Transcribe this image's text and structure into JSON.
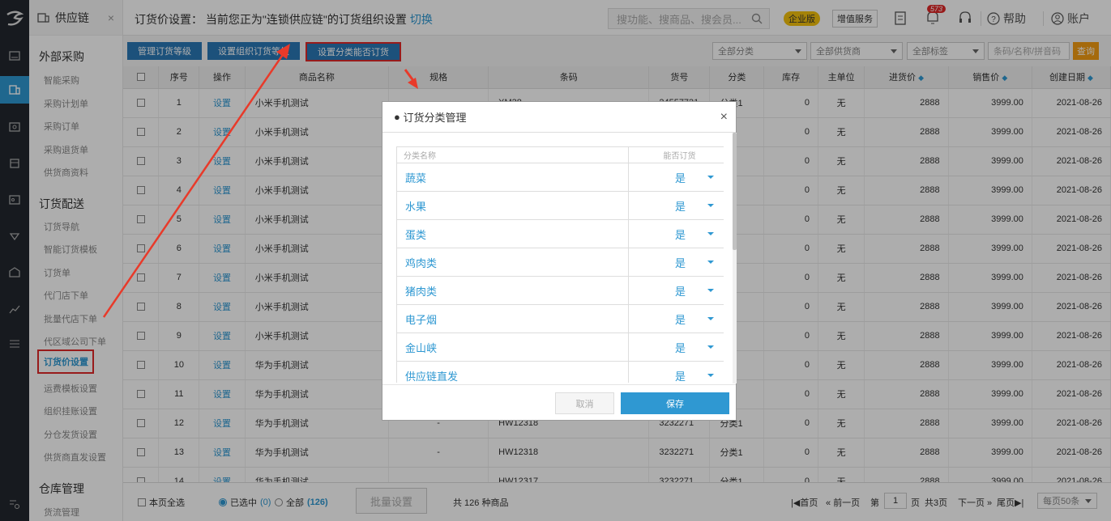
{
  "module": {
    "title": "供应链",
    "close": "×"
  },
  "sidebar": {
    "groups": [
      {
        "label": "外部采购",
        "items": [
          "智能采购",
          "采购计划单",
          "采购订单",
          "采购退货单",
          "供货商资料"
        ]
      },
      {
        "label": "订货配送",
        "items": [
          "订货导航",
          "智能订货模板",
          "订货单",
          "代门店下单",
          "批量代店下单",
          "代区域公司下单",
          "订货价设置",
          "运费模板设置",
          "组织挂账设置",
          "分仓发货设置",
          "供货商直发设置"
        ]
      },
      {
        "label": "仓库管理",
        "items": [
          "货流管理"
        ]
      }
    ],
    "selected": "订货价设置"
  },
  "header": {
    "title": "订货价设置：   当前您正为\"连锁供应链\"的订货组织设置",
    "switch": "切换",
    "search_placeholder": "搜功能、搜商品、搜会员...",
    "enterprise": "企业版",
    "value_added": "增值服务",
    "badge": "573",
    "help": "帮助",
    "account": "账户"
  },
  "toolbar": {
    "btn1": "管理订货等级",
    "btn2": "设置组织订货等级",
    "btn3": "设置分类能否订货",
    "cat": "全部分类",
    "supplier": "全部供货商",
    "tag": "全部标签",
    "search_placeholder": "条码/名称/拼音码",
    "query": "查询"
  },
  "table": {
    "headers": [
      "序号",
      "操作",
      "商品名称",
      "规格",
      "条码",
      "货号",
      "分类",
      "库存",
      "主单位",
      "进货价",
      "销售价",
      "创建日期"
    ],
    "rows": [
      {
        "no": "1",
        "op": "设置",
        "name": "小米手机测试",
        "spec": "",
        "code": "XM38",
        "sku": "24557731",
        "cat": "分类1",
        "stock": "0",
        "unit": "无",
        "buy": "2888",
        "sell": "3999.00",
        "date": "2021-08-26"
      },
      {
        "no": "2",
        "op": "设置",
        "name": "小米手机测试",
        "spec": "",
        "code": "",
        "sku": "",
        "cat": "",
        "stock": "0",
        "unit": "无",
        "buy": "2888",
        "sell": "3999.00",
        "date": "2021-08-26"
      },
      {
        "no": "3",
        "op": "设置",
        "name": "小米手机测试",
        "spec": "",
        "code": "",
        "sku": "",
        "cat": "",
        "stock": "0",
        "unit": "无",
        "buy": "2888",
        "sell": "3999.00",
        "date": "2021-08-26"
      },
      {
        "no": "4",
        "op": "设置",
        "name": "小米手机测试",
        "spec": "",
        "code": "",
        "sku": "",
        "cat": "",
        "stock": "0",
        "unit": "无",
        "buy": "2888",
        "sell": "3999.00",
        "date": "2021-08-26"
      },
      {
        "no": "5",
        "op": "设置",
        "name": "小米手机测试",
        "spec": "",
        "code": "",
        "sku": "",
        "cat": "",
        "stock": "0",
        "unit": "无",
        "buy": "2888",
        "sell": "3999.00",
        "date": "2021-08-26"
      },
      {
        "no": "6",
        "op": "设置",
        "name": "小米手机测试",
        "spec": "",
        "code": "",
        "sku": "",
        "cat": "",
        "stock": "0",
        "unit": "无",
        "buy": "2888",
        "sell": "3999.00",
        "date": "2021-08-26"
      },
      {
        "no": "7",
        "op": "设置",
        "name": "小米手机测试",
        "spec": "",
        "code": "",
        "sku": "",
        "cat": "",
        "stock": "0",
        "unit": "无",
        "buy": "2888",
        "sell": "3999.00",
        "date": "2021-08-26"
      },
      {
        "no": "8",
        "op": "设置",
        "name": "小米手机测试",
        "spec": "",
        "code": "",
        "sku": "",
        "cat": "",
        "stock": "0",
        "unit": "无",
        "buy": "2888",
        "sell": "3999.00",
        "date": "2021-08-26"
      },
      {
        "no": "9",
        "op": "设置",
        "name": "小米手机测试",
        "spec": "",
        "code": "",
        "sku": "",
        "cat": "",
        "stock": "0",
        "unit": "无",
        "buy": "2888",
        "sell": "3999.00",
        "date": "2021-08-26"
      },
      {
        "no": "10",
        "op": "设置",
        "name": "华为手机测试",
        "spec": "",
        "code": "",
        "sku": "",
        "cat": "",
        "stock": "0",
        "unit": "无",
        "buy": "2888",
        "sell": "3999.00",
        "date": "2021-08-26"
      },
      {
        "no": "11",
        "op": "设置",
        "name": "华为手机测试",
        "spec": "",
        "code": "",
        "sku": "",
        "cat": "",
        "stock": "0",
        "unit": "无",
        "buy": "2888",
        "sell": "3999.00",
        "date": "2021-08-26"
      },
      {
        "no": "12",
        "op": "设置",
        "name": "华为手机测试",
        "spec": "-",
        "code": "HW12318",
        "sku": "3232271",
        "cat": "分类1",
        "stock": "0",
        "unit": "无",
        "buy": "2888",
        "sell": "3999.00",
        "date": "2021-08-26"
      },
      {
        "no": "13",
        "op": "设置",
        "name": "华为手机测试",
        "spec": "-",
        "code": "HW12318",
        "sku": "3232271",
        "cat": "分类1",
        "stock": "0",
        "unit": "无",
        "buy": "2888",
        "sell": "3999.00",
        "date": "2021-08-26"
      },
      {
        "no": "14",
        "op": "设置",
        "name": "华为手机测试",
        "spec": "",
        "code": "HW12317",
        "sku": "3232271",
        "cat": "分类1",
        "stock": "0",
        "unit": "无",
        "buy": "2888",
        "sell": "3999.00",
        "date": "2021-08-26"
      }
    ]
  },
  "footer": {
    "page_all": "本页全选",
    "selected": "已选中",
    "selected_count": "(0)",
    "all": "全部",
    "all_count": "(126)",
    "bulk": "批量设置",
    "total": "共 126 种商品",
    "first": "首页",
    "prev": "前一页",
    "page_prefix": "第",
    "page": "1",
    "page_suffix": "页",
    "total_pages": "共3页",
    "next": "下一页",
    "last": "尾页",
    "per_page": "每页50条"
  },
  "dialog": {
    "title": "订货分类管理",
    "col_name": "分类名称",
    "col_can": "能否订货",
    "rows": [
      {
        "name": "蔬菜",
        "can": "是"
      },
      {
        "name": "水果",
        "can": "是"
      },
      {
        "name": "蛋类",
        "can": "是"
      },
      {
        "name": "鸡肉类",
        "can": "是"
      },
      {
        "name": "猪肉类",
        "can": "是"
      },
      {
        "name": "电子烟",
        "can": "是"
      },
      {
        "name": "金山峡",
        "can": "是"
      },
      {
        "name": "供应链直发",
        "can": "是"
      }
    ],
    "cancel": "取消",
    "save": "保存"
  }
}
